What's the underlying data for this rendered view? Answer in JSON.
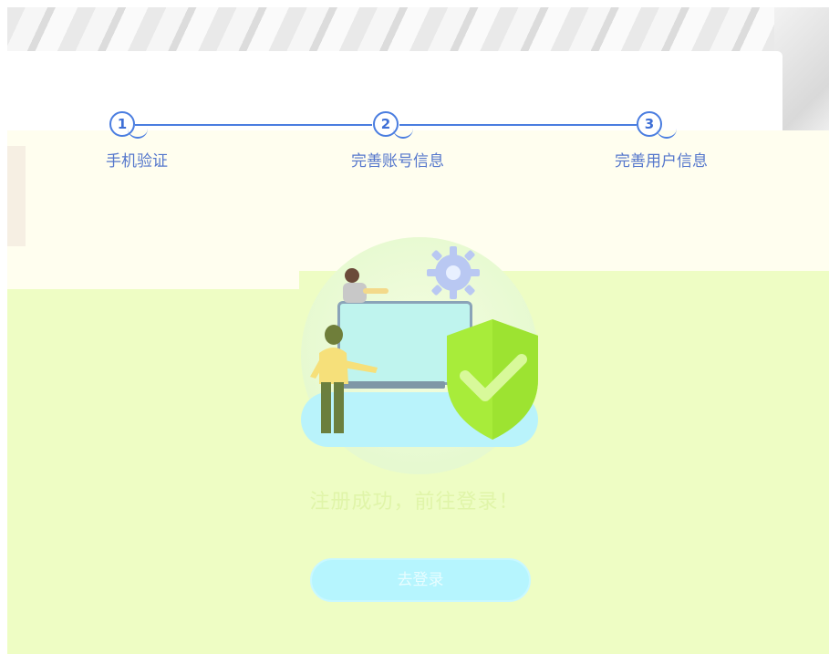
{
  "steps": [
    {
      "number": "1",
      "label": "手机验证"
    },
    {
      "number": "2",
      "label": "完善账号信息"
    },
    {
      "number": "3",
      "label": "完善用户信息"
    }
  ],
  "result": {
    "message": "注册成功，前往登录！",
    "button_label": "去登录"
  },
  "colors": {
    "accent": "#4a7de0",
    "shield": "#a8ec3a",
    "button": "#b6f5fe"
  }
}
